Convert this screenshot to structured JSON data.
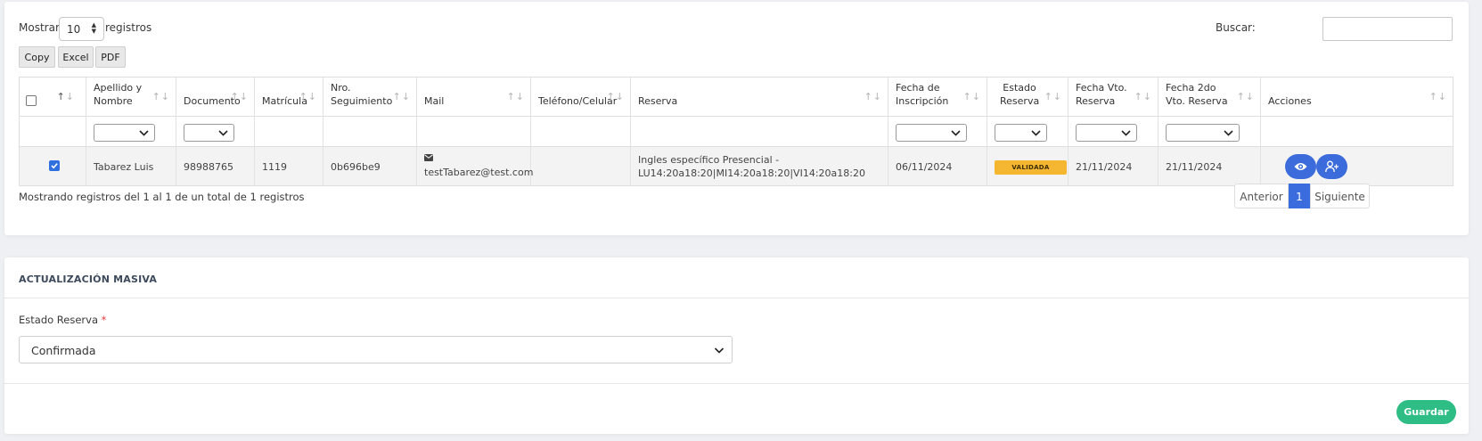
{
  "listing": {
    "show_label": "Mostrar",
    "length_value": "10",
    "records_label": "registros",
    "search_label": "Buscar:",
    "search_value": ""
  },
  "export_buttons": [
    "Copy",
    "Excel",
    "PDF"
  ],
  "table": {
    "columns": [
      {
        "key": "select",
        "label": ""
      },
      {
        "key": "nombre",
        "label": "Apellido y Nombre"
      },
      {
        "key": "documento",
        "label": "Documento"
      },
      {
        "key": "matricula",
        "label": "Matrícula"
      },
      {
        "key": "seguimiento",
        "label": "Nro. Seguimiento"
      },
      {
        "key": "mail",
        "label": "Mail"
      },
      {
        "key": "telefono",
        "label": "Teléfono/Celular"
      },
      {
        "key": "reserva",
        "label": "Reserva"
      },
      {
        "key": "fecha_inscripcion",
        "label": "Fecha de Inscripción"
      },
      {
        "key": "estado",
        "label": "Estado Reserva"
      },
      {
        "key": "vto",
        "label": "Fecha Vto. Reserva"
      },
      {
        "key": "vto2",
        "label": "Fecha 2do Vto. Reserva"
      },
      {
        "key": "acciones",
        "label": "Acciones"
      }
    ],
    "rows": [
      {
        "selected": true,
        "nombre": "Tabarez Luis",
        "documento": "98988765",
        "matricula": "1119",
        "seguimiento": "0b696be9",
        "mail": "testTabarez@test.com",
        "telefono": "",
        "reserva": "Ingles específico Presencial - LU14:20a18:20|MI14:20a18:20|VI14:20a18:20",
        "fecha_inscripcion": "06/11/2024",
        "estado": "VALIDADA",
        "vto": "21/11/2024",
        "vto2": "21/11/2024"
      }
    ],
    "info": "Mostrando registros del 1 al 1 de un total de 1 registros"
  },
  "pagination": {
    "prev": "Anterior",
    "current": "1",
    "next": "Siguiente"
  },
  "bulk_update": {
    "title": "ACTUALIZACIÓN MASIVA",
    "field_label": "Estado Reserva",
    "required_mark": "*",
    "selected_value": "Confirmada",
    "save_label": "Guardar"
  },
  "colors": {
    "primary": "#3b6cdd",
    "badge_validada": "#f5b731",
    "save_button": "#2ebd85"
  }
}
